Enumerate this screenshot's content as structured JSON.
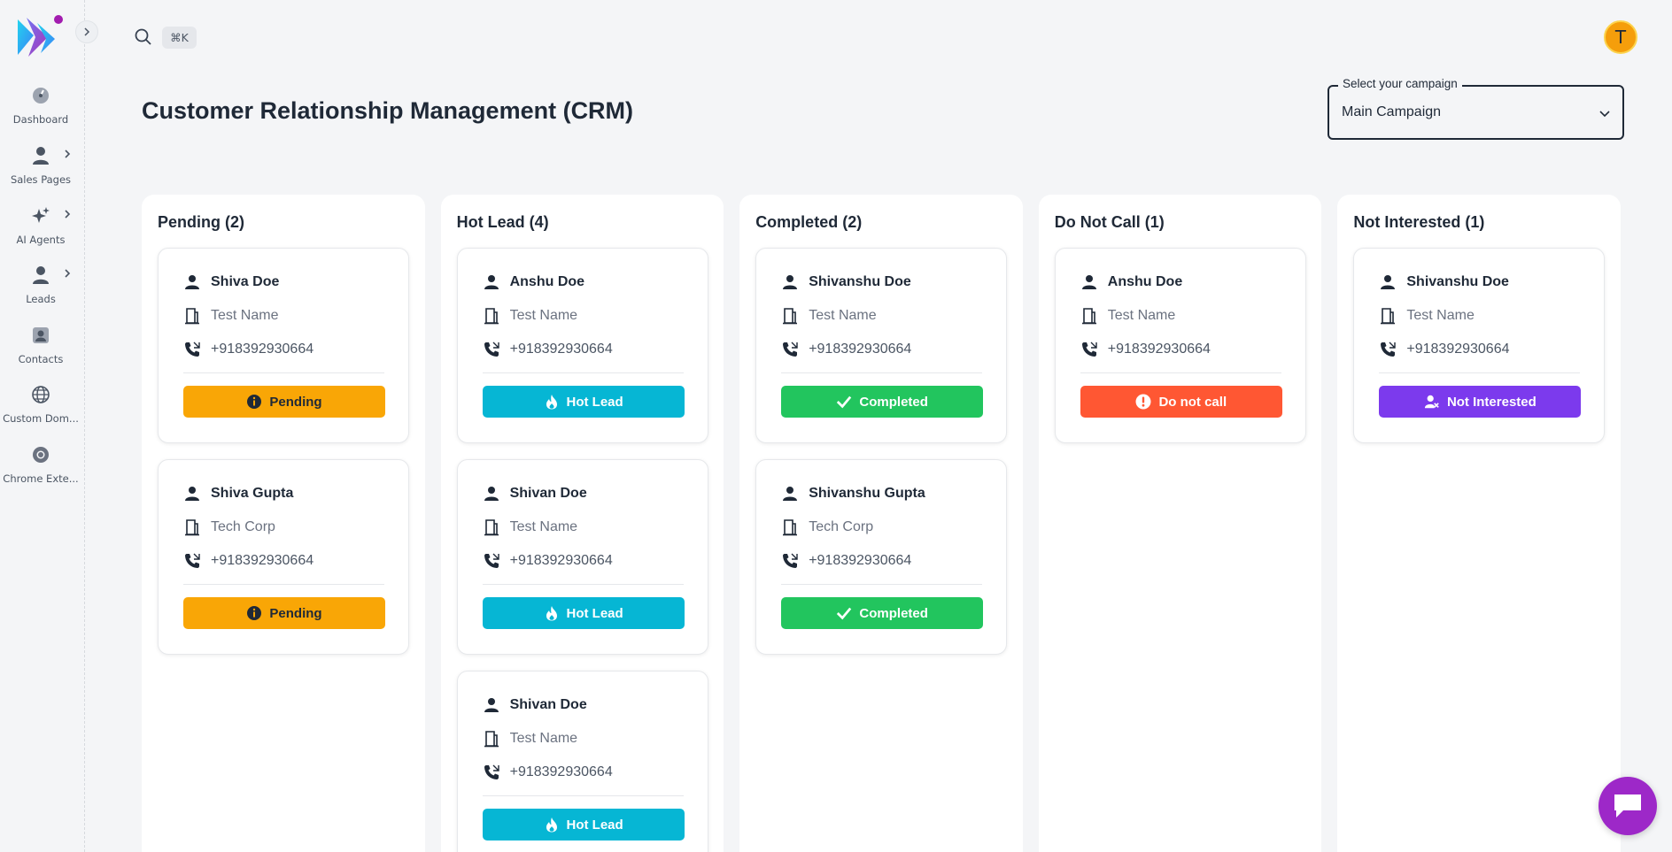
{
  "sidebar": {
    "items": [
      {
        "label": "Dashboard",
        "icon": "gauge-icon",
        "has_submenu": false
      },
      {
        "label": "Sales Pages",
        "icon": "person-icon",
        "has_submenu": true
      },
      {
        "label": "AI Agents",
        "icon": "sparkle-icon",
        "has_submenu": true
      },
      {
        "label": "Leads",
        "icon": "person-icon",
        "has_submenu": true
      },
      {
        "label": "Contacts",
        "icon": "contact-card-icon",
        "has_submenu": false
      },
      {
        "label": "Custom Dom...",
        "icon": "globe-icon",
        "has_submenu": false
      },
      {
        "label": "Chrome Exte...",
        "icon": "chrome-icon",
        "has_submenu": false
      }
    ]
  },
  "topbar": {
    "shortcut": "⌘K",
    "avatar_initial": "T"
  },
  "page": {
    "title": "Customer Relationship Management (CRM)"
  },
  "campaign": {
    "legend": "Select your campaign",
    "value": "Main Campaign"
  },
  "columns": [
    {
      "title": "Pending (2)",
      "cards": [
        {
          "name": "Shiva Doe",
          "company": "Test Name",
          "phone": "+918392930664",
          "status": "Pending"
        },
        {
          "name": "Shiva Gupta",
          "company": "Tech Corp",
          "phone": "+918392930664",
          "status": "Pending"
        }
      ]
    },
    {
      "title": "Hot Lead (4)",
      "cards": [
        {
          "name": "Anshu Doe",
          "company": "Test Name",
          "phone": "+918392930664",
          "status": "Hot Lead"
        },
        {
          "name": "Shivan Doe",
          "company": "Test Name",
          "phone": "+918392930664",
          "status": "Hot Lead"
        },
        {
          "name": "Shivan Doe",
          "company": "Test Name",
          "phone": "+918392930664",
          "status": "Hot Lead"
        }
      ]
    },
    {
      "title": "Completed (2)",
      "cards": [
        {
          "name": "Shivanshu Doe",
          "company": "Test Name",
          "phone": "+918392930664",
          "status": "Completed"
        },
        {
          "name": "Shivanshu Gupta",
          "company": "Tech Corp",
          "phone": "+918392930664",
          "status": "Completed"
        }
      ]
    },
    {
      "title": "Do Not Call (1)",
      "cards": [
        {
          "name": "Anshu Doe",
          "company": "Test Name",
          "phone": "+918392930664",
          "status": "Do not call"
        }
      ]
    },
    {
      "title": "Not Interested (1)",
      "cards": [
        {
          "name": "Shivanshu Doe",
          "company": "Test Name",
          "phone": "+918392930664",
          "status": "Not Interested"
        }
      ]
    }
  ],
  "colors": {
    "pending": "#f9a606",
    "hot_lead": "#06b6d4",
    "completed": "#22c55e",
    "do_not_call": "#ff5733",
    "not_interested": "#7c3aed",
    "chat_button": "#9d28c8"
  }
}
